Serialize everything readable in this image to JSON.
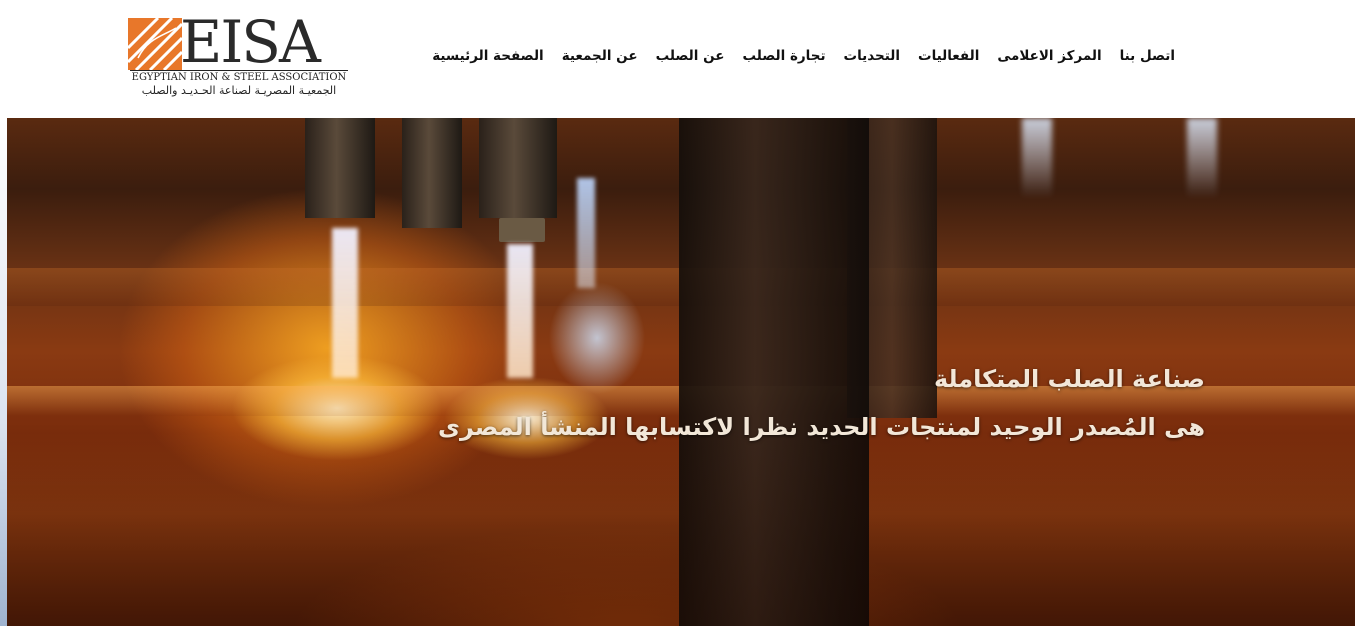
{
  "header": {
    "logo": {
      "word": "EISA",
      "subtitle_en": "EGYPTIAN IRON & STEEL ASSOCIATION",
      "subtitle_ar": "الجمعيـة المصريـة لصناعة الحـديـد والصلب",
      "brand_color": "#e8772a"
    },
    "nav": [
      {
        "label": "الصفحة الرئيسية"
      },
      {
        "label": "عن الجمعية"
      },
      {
        "label": "عن الصلب"
      },
      {
        "label": "تجارة الصلب"
      },
      {
        "label": "التحديات"
      },
      {
        "label": "الفعاليات"
      },
      {
        "label": "المركز الاعلامى"
      },
      {
        "label": "اتصل بنا"
      }
    ]
  },
  "hero": {
    "title": "صناعة الصلب المتكاملة",
    "subtitle": "هى المُصدر الوحيد لمنتجات الحديد نظرا لاكتسابها المنشأ المصرى",
    "text_color": "#f2e7d8"
  }
}
